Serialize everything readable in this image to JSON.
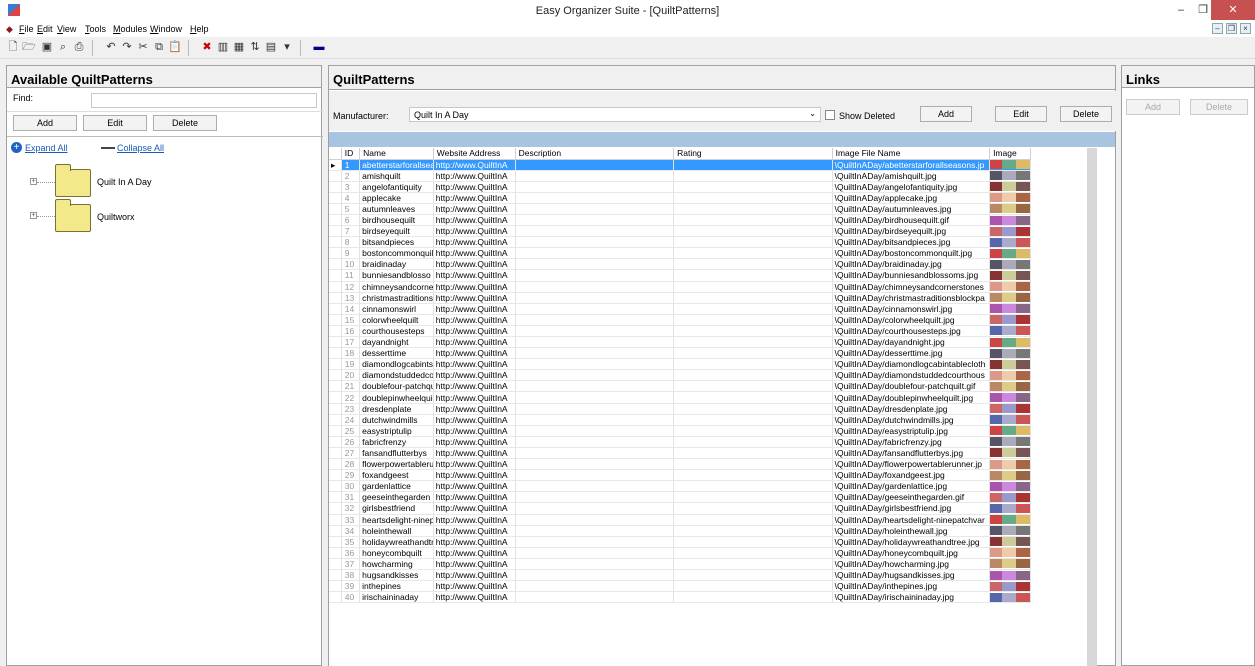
{
  "window": {
    "title": "Easy Organizer Suite - [QuiltPatterns]",
    "min": "–",
    "restore": "❐",
    "close": "✕"
  },
  "menu": [
    "File",
    "Edit",
    "View",
    "Tools",
    "Modules",
    "Window",
    "Help"
  ],
  "left": {
    "title": "Available QuiltPatterns",
    "find_label": "Find:",
    "find_value": "",
    "buttons": {
      "add": "Add",
      "edit": "Edit",
      "delete": "Delete"
    },
    "expand_all": "Expand All",
    "collapse_all": "Collapse All",
    "tree": [
      "Quilt In A Day",
      "Quiltworx"
    ]
  },
  "center": {
    "title": "QuiltPatterns",
    "manufacturer_label": "Manufacturer:",
    "manufacturer_value": "Quilt In A Day",
    "show_deleted": "Show Deleted",
    "buttons": {
      "add": "Add",
      "edit": "Edit",
      "delete": "Delete"
    },
    "columns": [
      "ID",
      "Name",
      "Website Address",
      "Description",
      "Rating",
      "Image File Name",
      "Image"
    ],
    "rows": [
      [
        "1",
        "abetterstarforallsea",
        "http://www.QuiltInA",
        "",
        "",
        "\\QuiltInADay/abetterstarforallseasons.jp"
      ],
      [
        "2",
        "amishquilt",
        "http://www.QuiltInA",
        "",
        "",
        "\\QuiltInADay/amishquilt.jpg"
      ],
      [
        "3",
        "angelofantiquity",
        "http://www.QuiltInA",
        "",
        "",
        "\\QuiltInADay/angelofantiquity.jpg"
      ],
      [
        "4",
        "applecake",
        "http://www.QuiltInA",
        "",
        "",
        "\\QuiltInADay/applecake.jpg"
      ],
      [
        "5",
        "autumnleaves",
        "http://www.QuiltInA",
        "",
        "",
        "\\QuiltInADay/autumnleaves.jpg"
      ],
      [
        "6",
        "birdhousequilt",
        "http://www.QuiltInA",
        "",
        "",
        "\\QuiltInADay/birdhousequilt.gif"
      ],
      [
        "7",
        "birdseyequilt",
        "http://www.QuiltInA",
        "",
        "",
        "\\QuiltInADay/birdseyequilt.jpg"
      ],
      [
        "8",
        "bitsandpieces",
        "http://www.QuiltInA",
        "",
        "",
        "\\QuiltInADay/bitsandpieces.jpg"
      ],
      [
        "9",
        "bostoncommonquilt",
        "http://www.QuiltInA",
        "",
        "",
        "\\QuiltInADay/bostoncommonquilt.jpg"
      ],
      [
        "10",
        "braidinaday",
        "http://www.QuiltInA",
        "",
        "",
        "\\QuiltInADay/braidinaday.jpg"
      ],
      [
        "11",
        "bunniesandblosso",
        "http://www.QuiltInA",
        "",
        "",
        "\\QuiltInADay/bunniesandblossoms.jpg"
      ],
      [
        "12",
        "chimneysandcorne",
        "http://www.QuiltInA",
        "",
        "",
        "\\QuiltInADay/chimneysandcornerstones"
      ],
      [
        "13",
        "christmastraditions",
        "http://www.QuiltInA",
        "",
        "",
        "\\QuiltInADay/christmastraditionsblockpa"
      ],
      [
        "14",
        "cinnamonswirl",
        "http://www.QuiltInA",
        "",
        "",
        "\\QuiltInADay/cinnamonswirl.jpg"
      ],
      [
        "15",
        "colorwheelquilt",
        "http://www.QuiltInA",
        "",
        "",
        "\\QuiltInADay/colorwheelquilt.jpg"
      ],
      [
        "16",
        "courthousesteps",
        "http://www.QuiltInA",
        "",
        "",
        "\\QuiltInADay/courthousesteps.jpg"
      ],
      [
        "17",
        "dayandnight",
        "http://www.QuiltInA",
        "",
        "",
        "\\QuiltInADay/dayandnight.jpg"
      ],
      [
        "18",
        "desserttime",
        "http://www.QuiltInA",
        "",
        "",
        "\\QuiltInADay/desserttime.jpg"
      ],
      [
        "19",
        "diamondlogcabints",
        "http://www.QuiltInA",
        "",
        "",
        "\\QuiltInADay/diamondlogcabintablecloth"
      ],
      [
        "20",
        "diamondstuddedco",
        "http://www.QuiltInA",
        "",
        "",
        "\\QuiltInADay/diamondstuddedcourthous"
      ],
      [
        "21",
        "doublefour-patchqu",
        "http://www.QuiltInA",
        "",
        "",
        "\\QuiltInADay/doublefour-patchquilt.gif"
      ],
      [
        "22",
        "doublepinwheelquil",
        "http://www.QuiltInA",
        "",
        "",
        "\\QuiltInADay/doublepinwheelquilt.jpg"
      ],
      [
        "23",
        "dresdenplate",
        "http://www.QuiltInA",
        "",
        "",
        "\\QuiltInADay/dresdenplate.jpg"
      ],
      [
        "24",
        "dutchwindmills",
        "http://www.QuiltInA",
        "",
        "",
        "\\QuiltInADay/dutchwindmills.jpg"
      ],
      [
        "25",
        "easystriptulip",
        "http://www.QuiltInA",
        "",
        "",
        "\\QuiltInADay/easystriptulip.jpg"
      ],
      [
        "26",
        "fabricfrenzy",
        "http://www.QuiltInA",
        "",
        "",
        "\\QuiltInADay/fabricfrenzy.jpg"
      ],
      [
        "27",
        "fansandflutterbys",
        "http://www.QuiltInA",
        "",
        "",
        "\\QuiltInADay/fansandflutterbys.jpg"
      ],
      [
        "28",
        "flowerpowertableru",
        "http://www.QuiltInA",
        "",
        "",
        "\\QuiltInADay/flowerpowertablerunner.jp"
      ],
      [
        "29",
        "foxandgeest",
        "http://www.QuiltInA",
        "",
        "",
        "\\QuiltInADay/foxandgeest.jpg"
      ],
      [
        "30",
        "gardenlattice",
        "http://www.QuiltInA",
        "",
        "",
        "\\QuiltInADay/gardenlattice.jpg"
      ],
      [
        "31",
        "geeseinthegarden",
        "http://www.QuiltInA",
        "",
        "",
        "\\QuiltInADay/geeseinthegarden.gif"
      ],
      [
        "32",
        "girlsbestfriend",
        "http://www.QuiltInA",
        "",
        "",
        "\\QuiltInADay/girlsbestfriend.jpg"
      ],
      [
        "33",
        "heartsdelight-ninep",
        "http://www.QuiltInA",
        "",
        "",
        "\\QuiltInADay/heartsdelight-ninepatchvar"
      ],
      [
        "34",
        "holeinthewall",
        "http://www.QuiltInA",
        "",
        "",
        "\\QuiltInADay/holeinthewall.jpg"
      ],
      [
        "35",
        "holidaywreathandtr",
        "http://www.QuiltInA",
        "",
        "",
        "\\QuiltInADay/holidaywreathandtree.jpg"
      ],
      [
        "36",
        "honeycombquilt",
        "http://www.QuiltInA",
        "",
        "",
        "\\QuiltInADay/honeycombquilt.jpg"
      ],
      [
        "37",
        "howcharming",
        "http://www.QuiltInA",
        "",
        "",
        "\\QuiltInADay/howcharming.jpg"
      ],
      [
        "38",
        "hugsandkisses",
        "http://www.QuiltInA",
        "",
        "",
        "\\QuiltInADay/hugsandkisses.jpg"
      ],
      [
        "39",
        "inthepines",
        "http://www.QuiltInA",
        "",
        "",
        "\\QuiltInADay/inthepines.jpg"
      ],
      [
        "40",
        "irischaininaday",
        "http://www.QuiltInA",
        "",
        "",
        "\\QuiltInADay/irischaininaday.jpg"
      ]
    ]
  },
  "right": {
    "title": "Links",
    "buttons": {
      "add": "Add",
      "delete": "Delete"
    }
  },
  "colors": {
    "selection": "#3399ff",
    "band": "#a8c4e0",
    "close": "#c75050"
  }
}
